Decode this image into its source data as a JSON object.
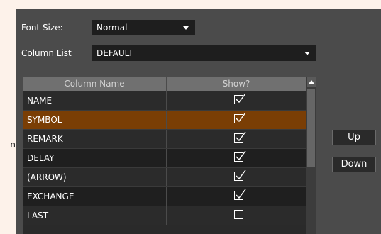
{
  "left_fragment": "n",
  "font_size": {
    "label": "Font Size:",
    "value": "Normal"
  },
  "column_list": {
    "label": "Column List",
    "value": "DEFAULT"
  },
  "grid": {
    "headers": {
      "name": "Column Name",
      "show": "Show?"
    },
    "rows": [
      {
        "name": "NAME",
        "show": true,
        "selected": false
      },
      {
        "name": "SYMBOL",
        "show": true,
        "selected": true
      },
      {
        "name": "REMARK",
        "show": true,
        "selected": false
      },
      {
        "name": "DELAY",
        "show": true,
        "selected": false
      },
      {
        "name": "(ARROW)",
        "show": true,
        "selected": false
      },
      {
        "name": "EXCHANGE",
        "show": true,
        "selected": false
      },
      {
        "name": "LAST",
        "show": false,
        "selected": false
      }
    ]
  },
  "buttons": {
    "up": "Up",
    "down": "Down"
  },
  "colors": {
    "background": "#fdf2ea",
    "panel": "#4b4b4b",
    "selected_row": "#7a3e05",
    "header": "#707070"
  }
}
